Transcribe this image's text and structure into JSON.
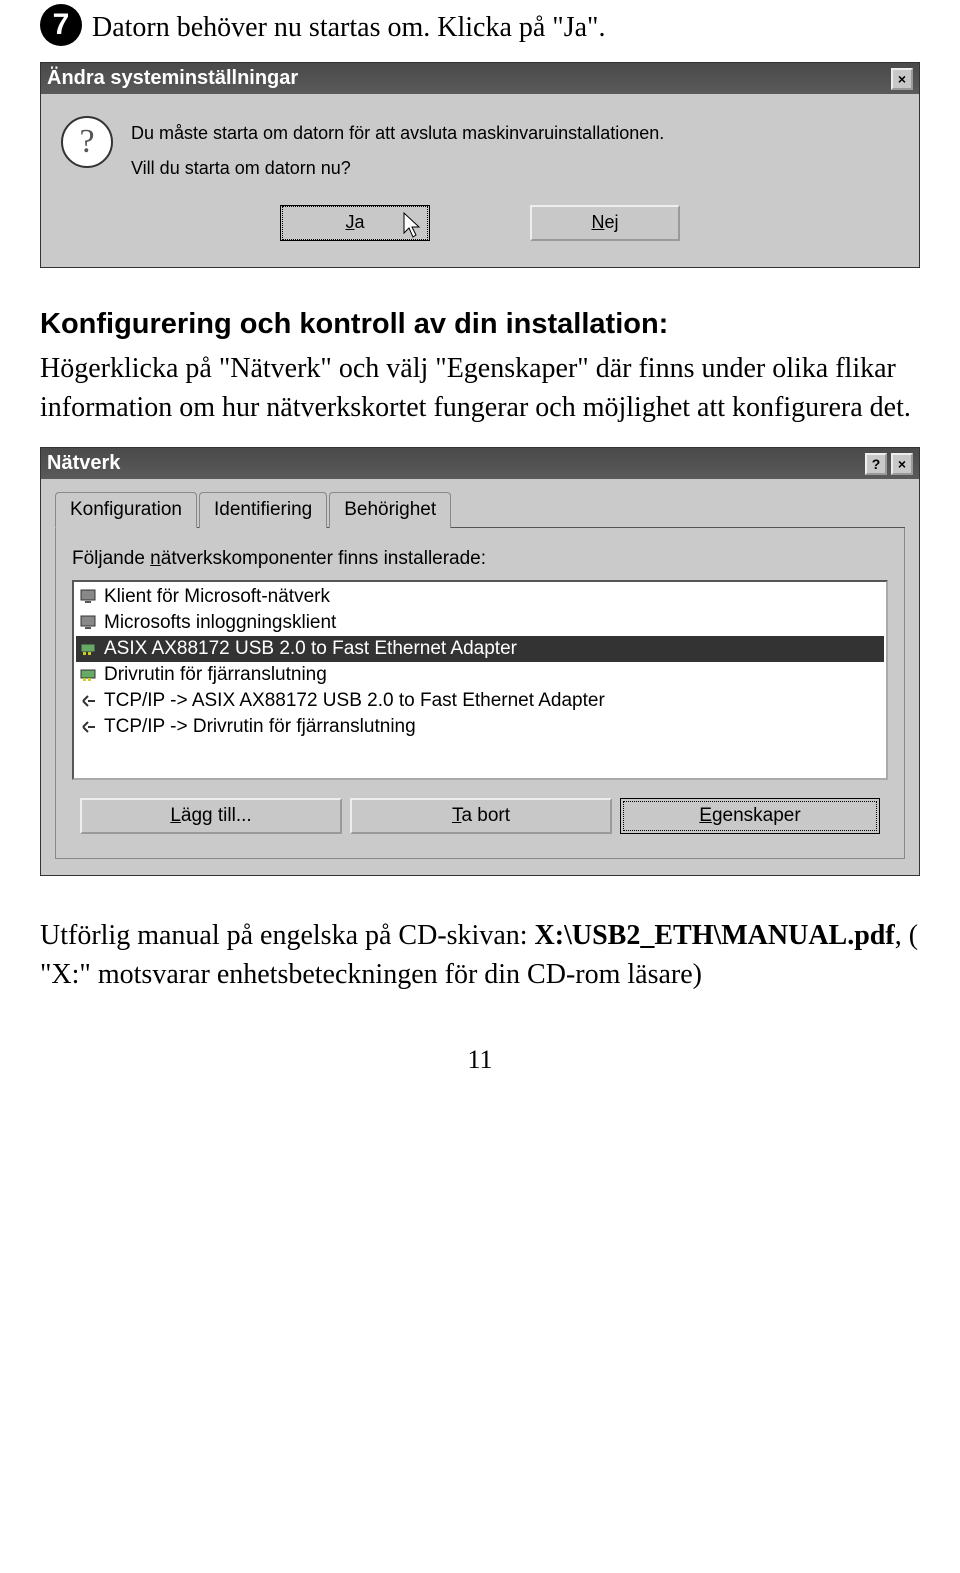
{
  "step": {
    "number": "7",
    "text": "Datorn behöver nu startas om. Klicka på \"Ja\"."
  },
  "dialog1": {
    "title": "Ändra systeminställningar",
    "line1": "Du måste starta om datorn för att avsluta maskinvaruinstallationen.",
    "line2": "Vill du starta om datorn nu?",
    "btn_yes": "Ja",
    "btn_no": "Nej",
    "close_icon": "×"
  },
  "section": {
    "heading": "Konfigurering och kontroll av din installation:",
    "body": "Högerklicka på \"Nätverk\" och välj \"Egenskaper\" där finns under olika flikar information om hur nätverkskortet fungerar och möjlighet att konfigurera det."
  },
  "dialog2": {
    "title": "Nätverk",
    "help_icon": "?",
    "close_icon": "×",
    "tabs": [
      {
        "label": "Konfiguration",
        "active": true
      },
      {
        "label": "Identifiering",
        "active": false
      },
      {
        "label": "Behörighet",
        "active": false
      }
    ],
    "list_label_pre": "Följande ",
    "list_label_u": "n",
    "list_label_post": "ätverkskomponenter finns installerade:",
    "items": [
      {
        "icon": "monitor",
        "label": "Klient för Microsoft-nätverk",
        "selected": false
      },
      {
        "icon": "monitor",
        "label": "Microsofts inloggningsklient",
        "selected": false
      },
      {
        "icon": "nic",
        "label": "ASIX AX88172 USB 2.0 to Fast Ethernet Adapter",
        "selected": true
      },
      {
        "icon": "nic",
        "label": "Drivrutin för fjärranslutning",
        "selected": false
      },
      {
        "icon": "proto",
        "label": "TCP/IP -> ASIX AX88172 USB 2.0 to Fast Ethernet Adapter",
        "selected": false
      },
      {
        "icon": "proto",
        "label": "TCP/IP -> Drivrutin för fjärranslutning",
        "selected": false
      }
    ],
    "btn_add_pre": "",
    "btn_add_u": "L",
    "btn_add_post": "ägg till...",
    "btn_remove_pre": "",
    "btn_remove_u": "T",
    "btn_remove_post": "a bort",
    "btn_props_pre": "",
    "btn_props_u": "E",
    "btn_props_post": "genskaper"
  },
  "footnote": {
    "line1_pre": "Utförlig manual på engelska på CD-skivan: ",
    "line1_bold": "X:\\USB2_ETH\\MANUAL.pdf",
    "line1_post": ", ( \"X:\" motsvarar enhetsbeteckningen för din CD-rom läsare)"
  },
  "page_number": "11"
}
